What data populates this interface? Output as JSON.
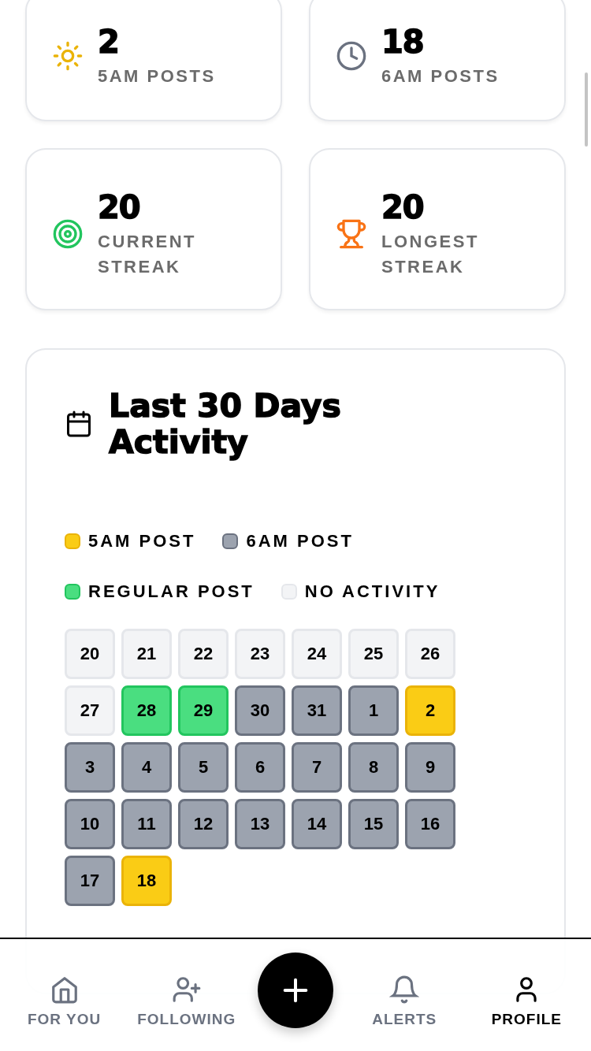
{
  "stats": [
    {
      "value": "2",
      "label": "5AM POSTS"
    },
    {
      "value": "18",
      "label": "6AM POSTS"
    },
    {
      "value": "20",
      "label": "CURRENT STREAK"
    },
    {
      "value": "20",
      "label": "LONGEST STREAK"
    }
  ],
  "activity": {
    "title": "Last 30 Days Activity",
    "legend": [
      {
        "kind": "fiveam",
        "label": "5AM POST"
      },
      {
        "kind": "sixam",
        "label": "6AM POST"
      },
      {
        "kind": "regular",
        "label": "REGULAR POST"
      },
      {
        "kind": "none",
        "label": "NO ACTIVITY"
      }
    ],
    "days": [
      {
        "label": "20",
        "kind": "none"
      },
      {
        "label": "21",
        "kind": "none"
      },
      {
        "label": "22",
        "kind": "none"
      },
      {
        "label": "23",
        "kind": "none"
      },
      {
        "label": "24",
        "kind": "none"
      },
      {
        "label": "25",
        "kind": "none"
      },
      {
        "label": "26",
        "kind": "none"
      },
      {
        "label": "27",
        "kind": "none"
      },
      {
        "label": "28",
        "kind": "regular"
      },
      {
        "label": "29",
        "kind": "regular"
      },
      {
        "label": "30",
        "kind": "sixam"
      },
      {
        "label": "31",
        "kind": "sixam"
      },
      {
        "label": "1",
        "kind": "sixam"
      },
      {
        "label": "2",
        "kind": "fiveam"
      },
      {
        "label": "3",
        "kind": "sixam"
      },
      {
        "label": "4",
        "kind": "sixam"
      },
      {
        "label": "5",
        "kind": "sixam"
      },
      {
        "label": "6",
        "kind": "sixam"
      },
      {
        "label": "7",
        "kind": "sixam"
      },
      {
        "label": "8",
        "kind": "sixam"
      },
      {
        "label": "9",
        "kind": "sixam"
      },
      {
        "label": "10",
        "kind": "sixam"
      },
      {
        "label": "11",
        "kind": "sixam"
      },
      {
        "label": "12",
        "kind": "sixam"
      },
      {
        "label": "13",
        "kind": "sixam"
      },
      {
        "label": "14",
        "kind": "sixam"
      },
      {
        "label": "15",
        "kind": "sixam"
      },
      {
        "label": "16",
        "kind": "sixam"
      },
      {
        "label": "17",
        "kind": "sixam"
      },
      {
        "label": "18",
        "kind": "fiveam"
      }
    ]
  },
  "nav": [
    {
      "label": "FOR YOU",
      "selected": false
    },
    {
      "label": "FOLLOWING",
      "selected": false
    },
    {
      "label": "ALERTS",
      "selected": false
    },
    {
      "label": "PROFILE",
      "selected": true
    }
  ]
}
